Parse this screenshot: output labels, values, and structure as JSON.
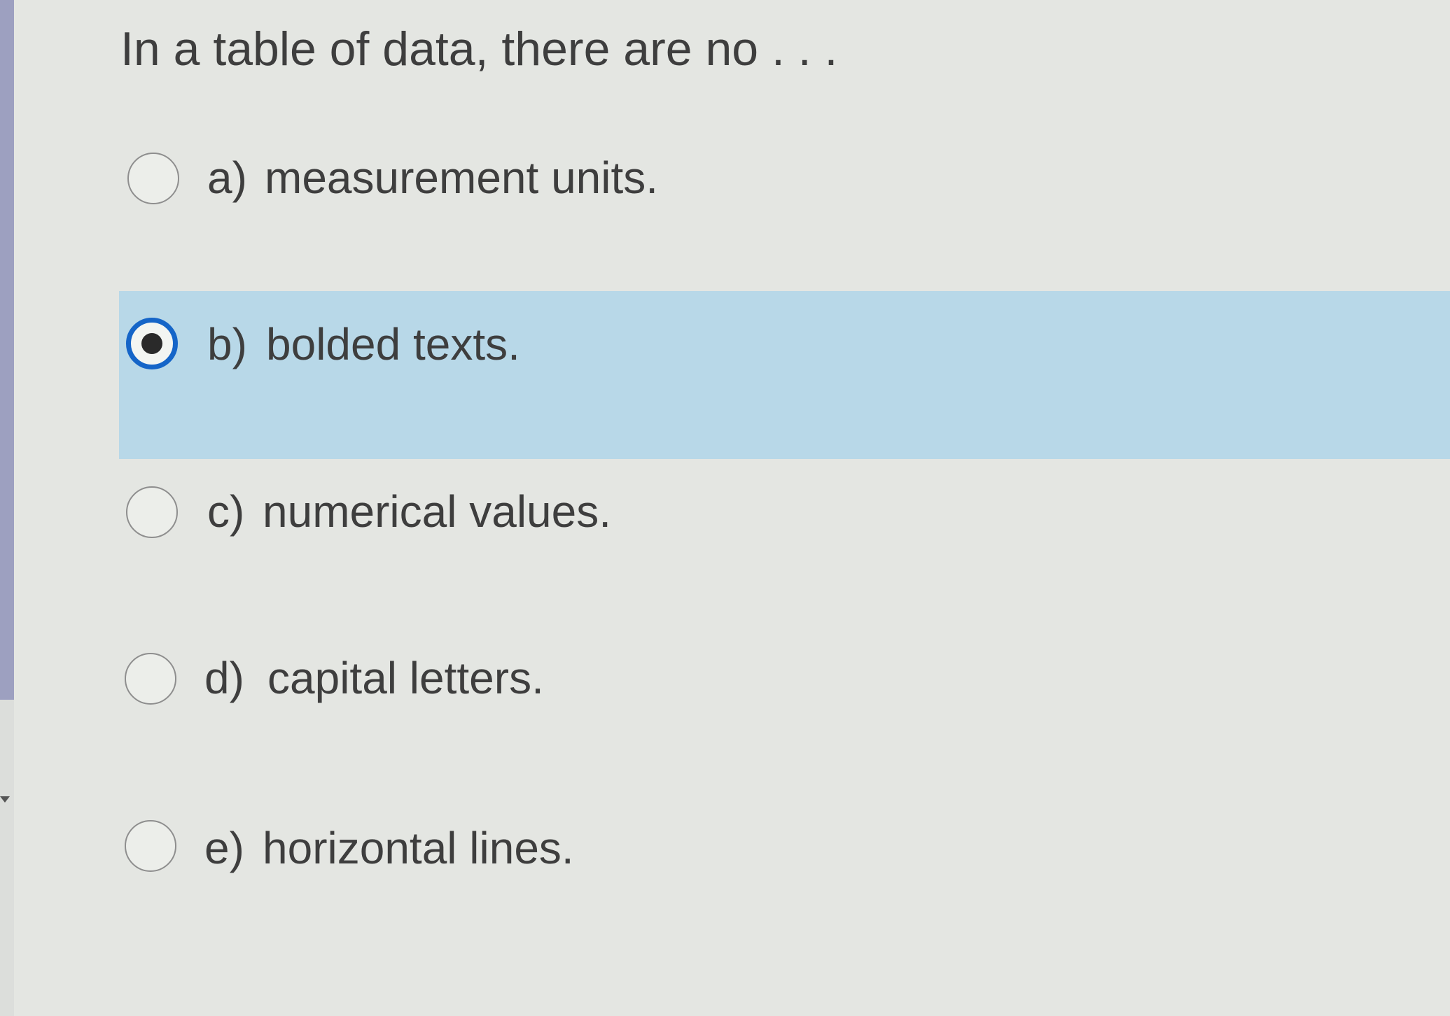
{
  "question": {
    "text": "In a table of data, there are no . . ."
  },
  "options": [
    {
      "letter": "a)",
      "text": "measurement units.",
      "selected": false
    },
    {
      "letter": "b)",
      "text": "bolded texts.",
      "selected": true
    },
    {
      "letter": "c)",
      "text": "numerical values.",
      "selected": false
    },
    {
      "letter": "d)",
      "text": "capital letters.",
      "selected": false
    },
    {
      "letter": "e)",
      "text": "horizontal lines.",
      "selected": false
    }
  ],
  "colors": {
    "selected_row_background": "#b8d8e8",
    "selected_radio_ring": "#1565c8",
    "text": "#3e3e3e",
    "page_background": "#e4e6e2"
  }
}
